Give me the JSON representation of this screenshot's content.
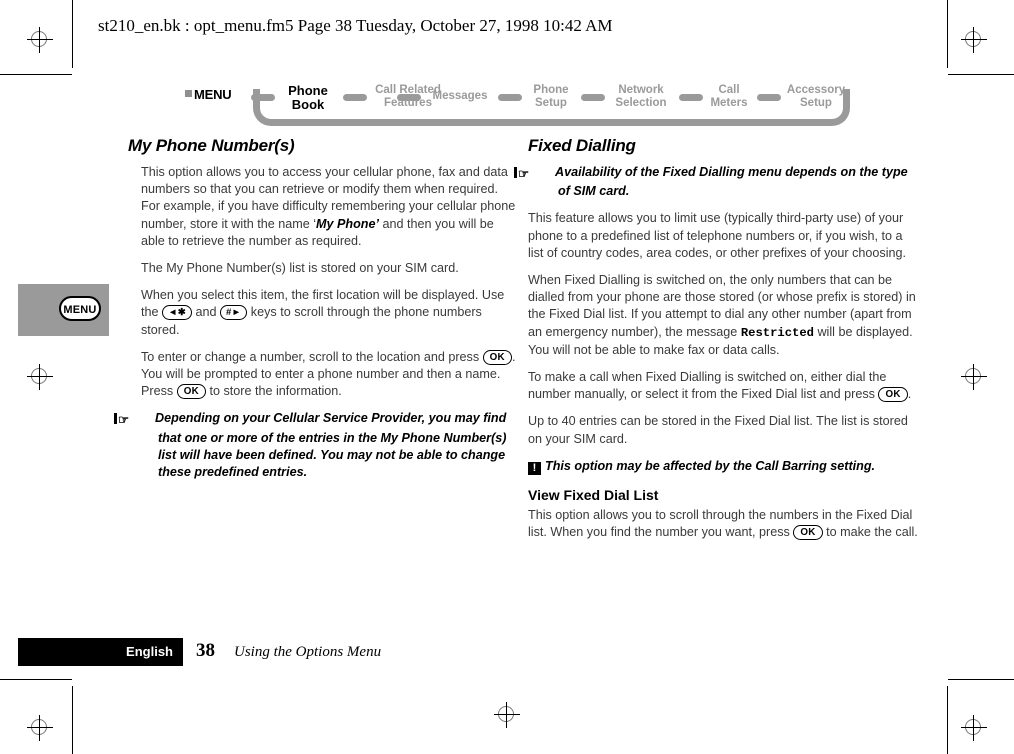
{
  "page_header": "st210_en.bk : opt_menu.fm5  Page 38  Tuesday, October 27, 1998  10:42 AM",
  "menu_bar": {
    "root_label": "MENU",
    "items": [
      {
        "line1": "Phone",
        "line2": "Book",
        "active": true
      },
      {
        "line1": "Call Related",
        "line2": "Features",
        "active": false
      },
      {
        "line1": "Messages",
        "line2": "",
        "active": false
      },
      {
        "line1": "Phone",
        "line2": "Setup",
        "active": false
      },
      {
        "line1": "Network",
        "line2": "Selection",
        "active": false
      },
      {
        "line1": "Call",
        "line2": "Meters",
        "active": false
      },
      {
        "line1": "Accessory",
        "line2": "Setup",
        "active": false
      }
    ]
  },
  "margin_tab": {
    "label": "MENU"
  },
  "left_column": {
    "title": "My Phone Number(s)",
    "p1_a": "This option allows you to access your cellular phone, fax and data numbers so that you can retrieve or modify them when required. For example, if you have difficulty remembering your cellular phone number, store it with the name ‘",
    "p1_strong": "My Phone’",
    "p1_b": " and then you will be able to retrieve the number as required.",
    "p2": "The My Phone Number(s) list is stored on your SIM card.",
    "p3_a": "When you select this item, the first location will be displayed. Use the ",
    "key_star": "◄✱",
    "p3_b": " and ",
    "key_hash": "#►",
    "p3_c": " keys to scroll through the phone numbers stored.",
    "p4_a": "To enter or change a number, scroll to the location and press ",
    "key_ok_1": "OK",
    "p4_b": ". You will be prompted to enter a phone number and then a name. Press ",
    "key_ok_2": "OK",
    "p4_c": " to store the information.",
    "note": "Depending on your Cellular Service Provider, you may find that one or more of the entries in the My Phone Number(s) list will have been defined. You may not be able to change these predefined entries."
  },
  "right_column": {
    "title": "Fixed Dialling",
    "note_1": "Availability of the Fixed Dialling menu depends on the type of SIM card.",
    "p1": "This feature allows you to limit use (typically third-party use) of your phone to a predefined list of telephone numbers or, if you wish, to a list of country codes, area codes, or other prefixes of your choosing.",
    "p2_a": "When Fixed Dialling is switched on, the only numbers that can be dialled from your phone are those stored (or whose prefix is stored) in the Fixed Dial list. If you attempt to dial any other number (apart from an emergency number), the message ",
    "p2_mono": "Restricted",
    "p2_b": " will be displayed. You will not be able to make fax or data calls.",
    "p3_a": "To make a call when Fixed Dialling is switched on, either dial the number manually, or select it from the Fixed Dial list and press ",
    "key_ok_1": "OK",
    "p3_b": ".",
    "p4": "Up to 40 entries can be stored in the Fixed Dial list. The list is stored on your SIM card.",
    "warning": "This option may be affected by the Call Barring setting.",
    "subsection_title": "View Fixed Dial List",
    "p5_a": "This option allows you to scroll through the numbers in the Fixed Dial list. When you find the number you want, press ",
    "key_ok_2": "OK",
    "p5_b": " to make the call."
  },
  "footer": {
    "language": "English",
    "page_number": "38",
    "chapter": "Using the Options Menu"
  },
  "icons": {
    "hand": "☞",
    "bang": "!"
  },
  "colors": {
    "menu_gray": "#9a9a9a",
    "body_text": "#3a3a3a",
    "black": "#000000"
  }
}
